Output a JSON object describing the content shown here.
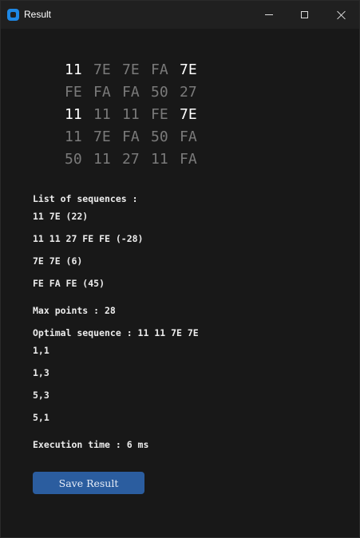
{
  "window": {
    "title": "Result"
  },
  "grid": [
    [
      {
        "v": "11",
        "hl": true
      },
      {
        "v": "7E",
        "hl": false
      },
      {
        "v": "7E",
        "hl": false
      },
      {
        "v": "FA",
        "hl": false
      },
      {
        "v": "7E",
        "hl": true
      }
    ],
    [
      {
        "v": "FE",
        "hl": false
      },
      {
        "v": "FA",
        "hl": false
      },
      {
        "v": "FA",
        "hl": false
      },
      {
        "v": "50",
        "hl": false
      },
      {
        "v": "27",
        "hl": false
      }
    ],
    [
      {
        "v": "11",
        "hl": true
      },
      {
        "v": "11",
        "hl": false
      },
      {
        "v": "11",
        "hl": false
      },
      {
        "v": "FE",
        "hl": false
      },
      {
        "v": "7E",
        "hl": true
      }
    ],
    [
      {
        "v": "11",
        "hl": false
      },
      {
        "v": "7E",
        "hl": false
      },
      {
        "v": "FA",
        "hl": false
      },
      {
        "v": "50",
        "hl": false
      },
      {
        "v": "FA",
        "hl": false
      }
    ],
    [
      {
        "v": "50",
        "hl": false
      },
      {
        "v": "11",
        "hl": false
      },
      {
        "v": "27",
        "hl": false
      },
      {
        "v": "11",
        "hl": false
      },
      {
        "v": "FA",
        "hl": false
      }
    ]
  ],
  "sequences": {
    "heading": "List of sequences :",
    "items": [
      "11 7E (22)",
      "11 11 27 FE FE (-28)",
      "7E 7E (6)",
      "FE FA FE (45)"
    ]
  },
  "max_points": "Max points : 28",
  "optimal": {
    "label": "Optimal sequence : 11 11 7E 7E",
    "coords": [
      "1,1",
      "1,3",
      "5,3",
      "5,1"
    ]
  },
  "execution_time": "Execution time : 6 ms",
  "save_button": "Save Result",
  "colors": {
    "highlight": "#ffffff",
    "dim": "#7a7a7a",
    "button": "#2b5d9f"
  }
}
